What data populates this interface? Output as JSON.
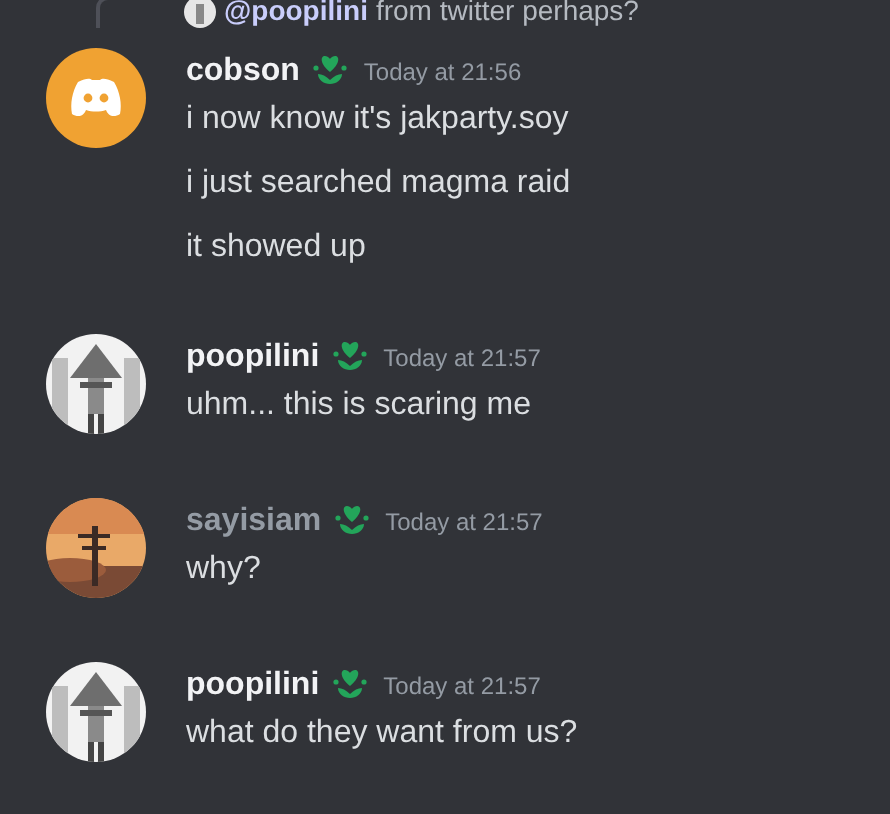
{
  "reply": {
    "mention": "@poopilini",
    "text": "from twitter perhaps?"
  },
  "groups": [
    {
      "author": "cobson",
      "color": "#f2f3f5",
      "kind": "default",
      "time": "Today at 21:56",
      "lines": [
        "i now know it's jakparty.soy",
        "i just searched magma raid",
        "it showed up"
      ]
    },
    {
      "author": "poopilini",
      "color": "#f2f3f5",
      "kind": "picture",
      "time": "Today at 21:57",
      "lines": [
        "uhm... this is scaring me"
      ]
    },
    {
      "author": "sayisiam",
      "color": "#949ba4",
      "kind": "sunset",
      "time": "Today at 21:57",
      "lines": [
        "why?"
      ]
    },
    {
      "author": "poopilini",
      "color": "#f2f3f5",
      "kind": "picture",
      "time": "Today at 21:57",
      "lines": [
        "what do they want from us?"
      ]
    }
  ]
}
